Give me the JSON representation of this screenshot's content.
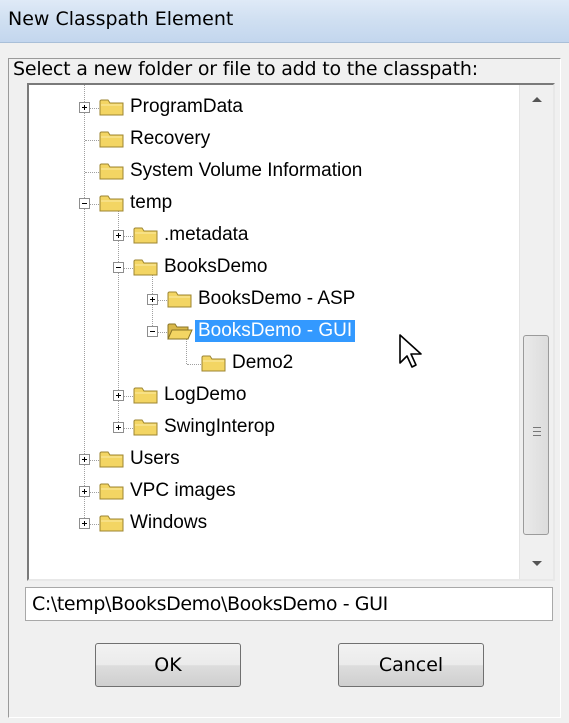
{
  "window": {
    "title": "New Classpath Element"
  },
  "prompt": "Select a new folder or file to add to the classpath:",
  "tree": [
    {
      "label": "ProgramData",
      "expander": "plus",
      "depth": 0
    },
    {
      "label": "Recovery",
      "expander": "none",
      "depth": 0
    },
    {
      "label": "System Volume Information",
      "expander": "none",
      "depth": 0
    },
    {
      "label": "temp",
      "expander": "minus",
      "depth": 0
    },
    {
      "label": ".metadata",
      "expander": "plus",
      "depth": 1
    },
    {
      "label": "BooksDemo",
      "expander": "minus",
      "depth": 1
    },
    {
      "label": "BooksDemo - ASP",
      "expander": "plus",
      "depth": 2
    },
    {
      "label": "BooksDemo - GUI",
      "expander": "minus",
      "depth": 2,
      "selected": true,
      "open": true
    },
    {
      "label": "Demo2",
      "expander": "none",
      "depth": 3
    },
    {
      "label": "LogDemo",
      "expander": "plus",
      "depth": 1
    },
    {
      "label": "SwingInterop",
      "expander": "plus",
      "depth": 1
    },
    {
      "label": "Users",
      "expander": "plus",
      "depth": 0
    },
    {
      "label": "VPC images",
      "expander": "plus",
      "depth": 0
    },
    {
      "label": "Windows",
      "expander": "plus",
      "depth": 0
    }
  ],
  "path_value": "C:\\temp\\BooksDemo\\BooksDemo - GUI",
  "buttons": {
    "ok": "OK",
    "cancel": "Cancel"
  },
  "colors": {
    "selection": "#3399ff",
    "folder": "#f3d563"
  }
}
